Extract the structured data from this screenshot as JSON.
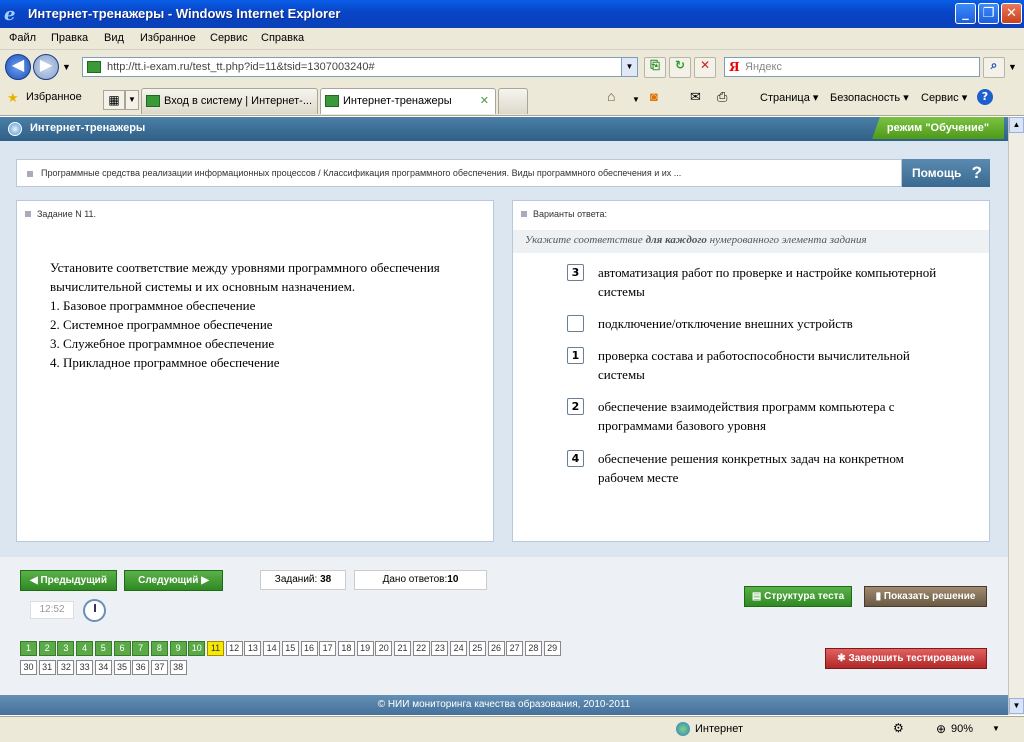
{
  "window": {
    "title": "Интернет-тренажеры - Windows Internet Explorer"
  },
  "menu": [
    "Файл",
    "Правка",
    "Вид",
    "Избранное",
    "Сервис",
    "Справка"
  ],
  "address": {
    "url": "http://tt.i-exam.ru/test_tt.php?id=11&tsid=1307003240#"
  },
  "search": {
    "placeholder": "Яндекс"
  },
  "favbar": {
    "favorites": "Избранное"
  },
  "tabs": [
    {
      "label": "Вход в систему | Интернет-..."
    },
    {
      "label": "Интернет-тренажеры"
    }
  ],
  "commands": {
    "page": "Страница",
    "security": "Безопасность",
    "service": "Сервис"
  },
  "app": {
    "title": "Интернет-тренажеры",
    "mode": "режим \"Обучение\"",
    "breadcrumb": "Программные средства реализации информационных процессов / Классификация программного обеспечения. Виды программного обеспечения и их ...",
    "help": "Помощь",
    "help_q": "?"
  },
  "task": {
    "header": "Задание N 11.",
    "text": "Установите соответствие между уровнями программного обеспечения вычислительной системы и их основным назначением.",
    "items": [
      "1. Базовое программное обеспечение",
      "2. Системное программное обеспечение",
      "3. Служебное программное обеспечение",
      "4. Прикладное программное обеспечение"
    ]
  },
  "answers": {
    "header": "Варианты ответа:",
    "hint_pre": "Укажите соответствие ",
    "hint_bold": "для каждого",
    "hint_post": " нумерованного элемента задания",
    "options": [
      {
        "value": "3",
        "text": "автоматизация работ по проверке и настройке компьютерной системы"
      },
      {
        "value": "",
        "text": "подключение/отключение внешних устройств"
      },
      {
        "value": "1",
        "text": "проверка состава и работоспособности вычислительной системы"
      },
      {
        "value": "2",
        "text": "обеспечение взаимодействия программ компьютера с программами базового уровня"
      },
      {
        "value": "4",
        "text": "обеспечение решения конкретных задач на конкретном рабочем месте"
      }
    ]
  },
  "nav": {
    "prev": "Предыдущий",
    "next": "Следующий",
    "tasks_label": "Заданий:",
    "tasks_count": "38",
    "answered_label": "Дано ответов:",
    "answered_count": "10",
    "time": "12:52",
    "structure": "Структура теста",
    "solution": "Показать решение",
    "finish": "Завершить тестирование"
  },
  "question_numbers": {
    "total": 38,
    "done_through": 10,
    "current": 11
  },
  "footer": "© НИИ мониторинга качества образования, 2010-2011",
  "status": {
    "zone": "Интернет",
    "zoom": "90%"
  }
}
